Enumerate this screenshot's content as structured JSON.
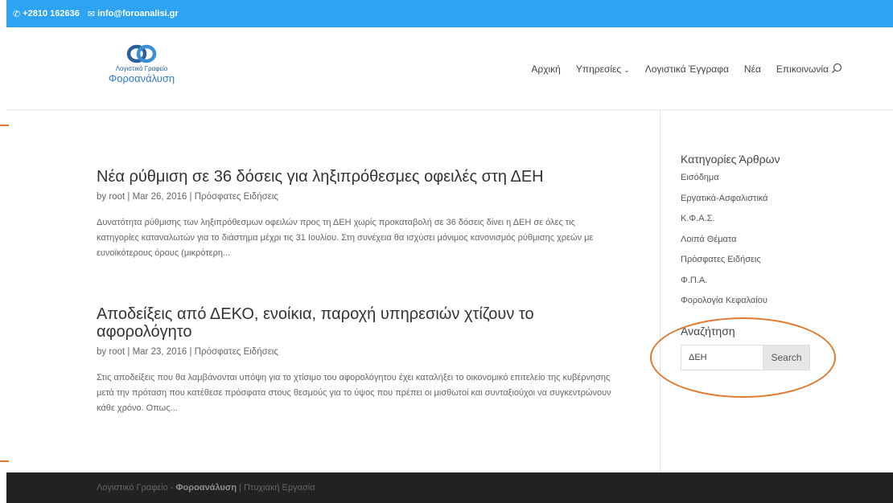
{
  "topbar": {
    "phone": "+2810 162636",
    "email": "info@foroanalisi.gr",
    "background": "#2ea3f2"
  },
  "header": {
    "logo_line1": "Λογιστικό Γραφείο",
    "logo_line2": "Φοροανάλυση",
    "nav": [
      {
        "label": "Αρχική"
      },
      {
        "label": "Υπηρεσίες",
        "has_dropdown": true
      },
      {
        "label": "Λογιστικά Έγγραφα"
      },
      {
        "label": "Νέα"
      },
      {
        "label": "Επικοινωνία"
      }
    ]
  },
  "posts": [
    {
      "title": "Νέα ρύθμιση σε 36 δόσεις για ληξιπρόθεσμες οφειλές στη ΔΕΗ",
      "author": "root",
      "date": "Mar 26, 2016",
      "category": "Πρόσφατες Ειδήσεις",
      "excerpt": "Δυνατότητα ρύθμισης των ληξιπρόθεσμων οφειλών προς τη ΔΕΗ χωρίς προκαταβολή σε 36 δόσεις δίνει η ΔΕΗ σε όλες τις κατηγορίες καταναλωτών για το διάστημα μέχρι τις 31 Ιουλίου. Στη συνέχεια θα ισχύσει μόνιμος κανονισμός ρύθμισης χρεών με ευνοϊκότερους όρους (μικρότερη..."
    },
    {
      "title": "Αποδείξεις από ΔΕΚΟ, ενοίκια, παροχή υπηρεσιών χτίζουν το αφορολόγητο",
      "author": "root",
      "date": "Mar 23, 2016",
      "category": "Πρόσφατες Ειδήσεις",
      "excerpt": "Στις αποδείξεις που θα λαμβάνονται υπόψη για το χτίσιμο του αφορολόγητου έχει καταλήξει το οικονομικό επιτελείο της κυβέρνησης μετά την πρόταση που κατέθεσε πρόσφατα στους θεσμούς για το ύψος που πρέπει οι μισθωτοί και συνταξιούχοι να συγκεντρώνουν κάθε χρόνο. Οπως..."
    }
  ],
  "sidebar": {
    "categories_title": "Κατηγορίες Άρθρων",
    "categories": [
      "Εισόδημα",
      "Εργατικά-Ασφαλιστικά",
      "Κ.Φ.Α.Σ.",
      "Λοιπά Θέματα",
      "Πρόσφατες Ειδήσεις",
      "Φ.Π.Α.",
      "Φορολογία Κεφαλαίου"
    ],
    "search_title": "Αναζήτηση",
    "search_value": "ΔΕΗ",
    "search_button": "Search"
  },
  "footer": {
    "prefix": "Λογιστικό Γραφείο -",
    "brand": "Φοροανάλυση",
    "suffix": "| Πτυχιακή Εργασία"
  },
  "colors": {
    "accent": "#2ea3f2",
    "annotation": "#e07a2e",
    "footer_bg": "#222222"
  }
}
